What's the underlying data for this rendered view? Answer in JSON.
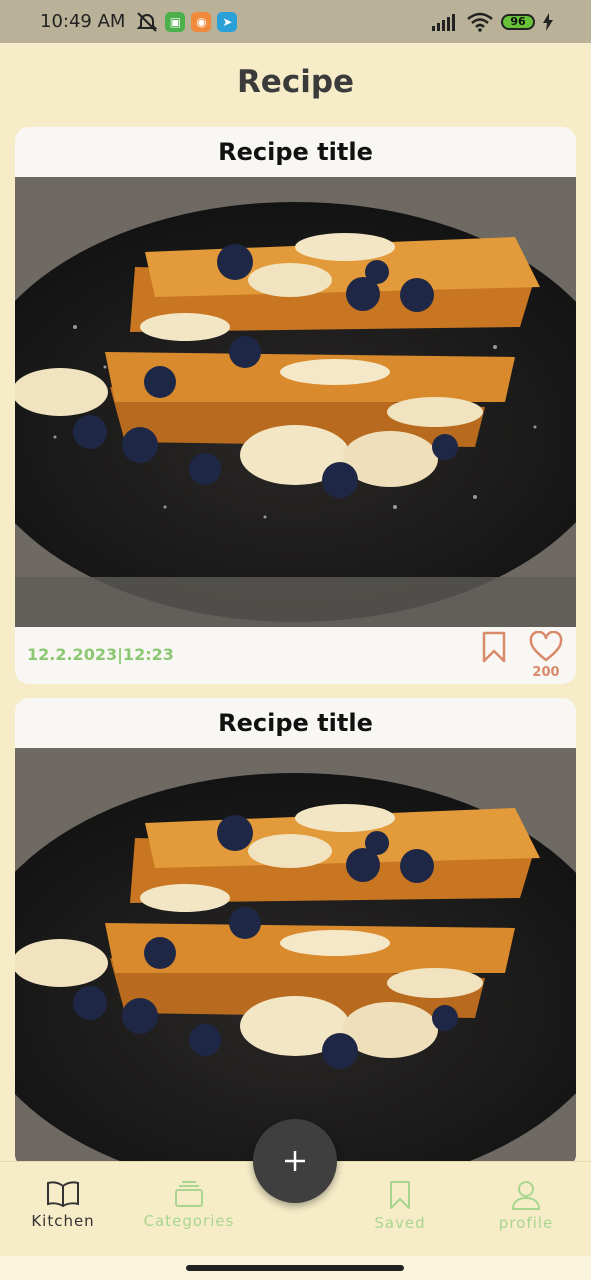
{
  "status_bar": {
    "time": "10:49 AM",
    "battery": "96",
    "icons": [
      "mute-icon",
      "android-app-icon",
      "mi-app-icon",
      "telegram-icon",
      "signal-icon",
      "wifi-icon",
      "battery-icon",
      "charging-icon"
    ]
  },
  "header": {
    "title": "Recipe"
  },
  "recipes": [
    {
      "title": "Recipe title",
      "date": "12.2.2023|12:23",
      "likes": "200",
      "image": "french-toast-photo"
    },
    {
      "title": "Recipe title",
      "image": "french-toast-photo"
    }
  ],
  "fab": {
    "icon": "plus-icon"
  },
  "nav": {
    "items": [
      {
        "label": "Kitchen",
        "icon": "book-icon",
        "active": true
      },
      {
        "label": "Categories",
        "icon": "layers-icon",
        "active": false
      },
      {
        "label": "Saved",
        "icon": "bookmark-icon",
        "active": false
      },
      {
        "label": "profile",
        "icon": "user-icon",
        "active": false
      }
    ]
  },
  "colors": {
    "background": "#f6ecc8",
    "accent_green": "#8cc873",
    "accent_orange": "#d98a6a",
    "fab": "#3f3f3f"
  }
}
